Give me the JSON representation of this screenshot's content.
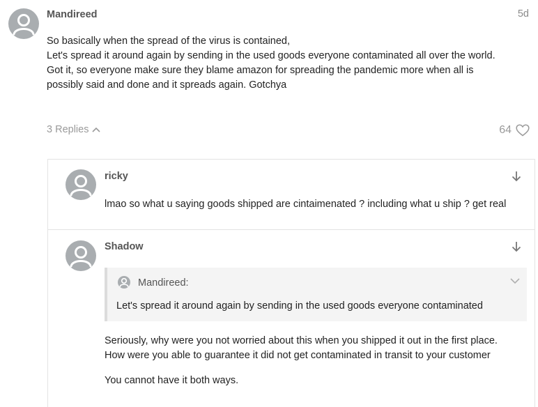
{
  "post": {
    "username": "Mandireed",
    "timestamp": "5d",
    "body_lines": [
      "So basically when the spread of the virus is contained,",
      "Let's spread it around again by sending in the used goods everyone contaminated all over the world.",
      "Got it, so everyone make sure they blame amazon for spreading the pandemic more when all is",
      "possibly said and done and it spreads again. Gotchya"
    ],
    "replies_label": "3 Replies",
    "likes_count": "64"
  },
  "replies": [
    {
      "username": "ricky",
      "text_lines": [
        "lmao so what u saying goods shipped are cintaimenated ? including what u ship ? get real"
      ]
    },
    {
      "username": "Shadow",
      "quote": {
        "author": "Mandireed:",
        "text": "Let's spread it around again by sending in the used goods everyone contaminated"
      },
      "text_lines": [
        "Seriously, why were you not worried about this when you shipped it out in the first place.",
        "How were you able to guarantee it did not get contaminated in transit to your customer"
      ],
      "text_lines_2": [
        "You cannot have it both ways."
      ]
    }
  ],
  "colors": {
    "avatar_bg": "#a9adb0",
    "muted_text": "#9a9a9a",
    "username_text": "#555555",
    "border": "#e3e3e3",
    "quote_bg": "#f4f4f4"
  },
  "icons": {
    "avatar": "default-user-icon",
    "replies_toggle": "chevron-up-icon",
    "like": "heart-outline-icon",
    "jump": "arrow-down-icon",
    "quote_expand": "chevron-down-icon"
  }
}
